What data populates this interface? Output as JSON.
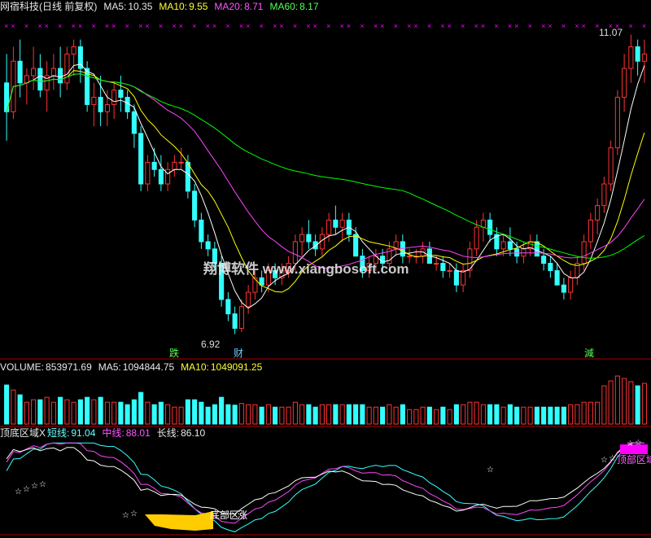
{
  "price_header": {
    "title": "网宿科技(日线 前复权)",
    "ma5_label": "MA5:",
    "ma5_value": "10.35",
    "ma10_label": "MA10:",
    "ma10_value": "9.55",
    "ma20_label": "MA20:",
    "ma20_value": "8.71",
    "ma60_label": "MA60:",
    "ma60_value": "8.17"
  },
  "volume_header": {
    "volume_label": "VOLUME:",
    "volume_value": "853971.69",
    "ma5_label": "MA5:",
    "ma5_value": "1094844.75",
    "ma10_label": "MA10:",
    "ma10_value": "1049091.25"
  },
  "indicator_header": {
    "title": "顶底区域X",
    "short_label": "短线:",
    "short_value": "91.04",
    "mid_label": "中线:",
    "mid_value": "88.01",
    "long_label": "长线:",
    "long_value": "86.10"
  },
  "annotations": {
    "high_price": "11.07",
    "low_price": "6.92",
    "marker_drop": "跌",
    "marker_wealth": "财",
    "marker_reduce": "減",
    "watermark": "翔博软件 www.xiangbosoft.com",
    "bottom_zone_label": "底部区",
    "rise_label": "涨",
    "top_zone_label": "顶部区域",
    "star_marker": "☆",
    "cross_marker": "×"
  },
  "colors": {
    "background": "#000000",
    "up": "#ff3333",
    "down": "#33ffff",
    "ma5": "#ffffff",
    "ma10": "#ffff00",
    "ma20": "#ff44ff",
    "ma60": "#00ff00",
    "divider": "#aa0000",
    "bottom_zone": "#ffcc00",
    "top_zone": "#ff00ff"
  },
  "chart_data": {
    "type": "candlestick",
    "title": "网宿科技(日线 前复权)",
    "candles": [
      [
        10.4,
        10.8,
        9.6,
        10.0
      ],
      [
        10.0,
        10.9,
        9.9,
        10.7
      ],
      [
        10.7,
        11.0,
        10.2,
        10.4
      ],
      [
        10.4,
        10.6,
        10.1,
        10.5
      ],
      [
        10.5,
        10.9,
        10.3,
        10.6
      ],
      [
        10.6,
        10.8,
        10.2,
        10.3
      ],
      [
        10.3,
        10.7,
        10.0,
        10.5
      ],
      [
        10.5,
        10.8,
        10.3,
        10.6
      ],
      [
        10.6,
        10.9,
        10.2,
        10.4
      ],
      [
        10.4,
        10.9,
        10.3,
        10.8
      ],
      [
        10.8,
        11.0,
        10.5,
        10.9
      ],
      [
        10.9,
        11.0,
        10.4,
        10.6
      ],
      [
        10.6,
        10.7,
        10.0,
        10.1
      ],
      [
        10.1,
        10.4,
        9.8,
        10.2
      ],
      [
        10.2,
        10.5,
        9.8,
        10.0
      ],
      [
        10.0,
        10.3,
        9.8,
        10.1
      ],
      [
        10.1,
        10.4,
        9.9,
        10.3
      ],
      [
        10.3,
        10.5,
        10.0,
        10.2
      ],
      [
        10.2,
        10.3,
        9.9,
        10.0
      ],
      [
        10.0,
        10.1,
        9.5,
        9.7
      ],
      [
        9.7,
        9.8,
        8.9,
        9.0
      ],
      [
        9.0,
        9.4,
        8.9,
        9.3
      ],
      [
        9.3,
        9.5,
        9.1,
        9.2
      ],
      [
        9.2,
        9.4,
        8.9,
        9.0
      ],
      [
        9.0,
        9.3,
        8.9,
        9.2
      ],
      [
        9.2,
        9.4,
        9.1,
        9.3
      ],
      [
        9.3,
        9.5,
        9.2,
        9.3
      ],
      [
        9.3,
        9.4,
        8.8,
        8.9
      ],
      [
        8.9,
        9.0,
        8.4,
        8.5
      ],
      [
        8.5,
        8.6,
        8.1,
        8.2
      ],
      [
        8.2,
        8.3,
        8.0,
        8.1
      ],
      [
        8.1,
        8.2,
        7.8,
        7.9
      ],
      [
        7.9,
        8.0,
        7.3,
        7.4
      ],
      [
        7.4,
        7.5,
        7.1,
        7.2
      ],
      [
        7.2,
        7.3,
        6.92,
        7.0
      ],
      [
        7.0,
        7.4,
        6.95,
        7.3
      ],
      [
        7.3,
        7.6,
        7.2,
        7.5
      ],
      [
        7.5,
        7.8,
        7.4,
        7.7
      ],
      [
        7.7,
        7.8,
        7.5,
        7.6
      ],
      [
        7.6,
        7.9,
        7.5,
        7.8
      ],
      [
        7.8,
        7.9,
        7.6,
        7.7
      ],
      [
        7.7,
        7.9,
        7.6,
        7.8
      ],
      [
        7.8,
        8.0,
        7.7,
        7.9
      ],
      [
        7.9,
        8.3,
        7.8,
        8.2
      ],
      [
        8.2,
        8.4,
        8.0,
        8.3
      ],
      [
        8.3,
        8.5,
        8.1,
        8.2
      ],
      [
        8.2,
        8.3,
        8.0,
        8.1
      ],
      [
        8.1,
        8.4,
        8.0,
        8.3
      ],
      [
        8.3,
        8.6,
        8.2,
        8.5
      ],
      [
        8.5,
        8.7,
        8.3,
        8.4
      ],
      [
        8.4,
        8.6,
        8.2,
        8.5
      ],
      [
        8.5,
        8.6,
        8.2,
        8.3
      ],
      [
        8.3,
        8.4,
        8.0,
        8.0
      ],
      [
        8.0,
        8.1,
        7.7,
        7.8
      ],
      [
        7.8,
        8.0,
        7.7,
        7.9
      ],
      [
        7.9,
        8.1,
        7.8,
        8.0
      ],
      [
        8.0,
        8.1,
        7.8,
        7.9
      ],
      [
        7.9,
        8.2,
        7.8,
        8.1
      ],
      [
        8.1,
        8.3,
        8.0,
        8.2
      ],
      [
        8.2,
        8.3,
        7.9,
        8.0
      ],
      [
        8.0,
        8.1,
        7.9,
        8.0
      ],
      [
        8.0,
        8.1,
        7.9,
        8.0
      ],
      [
        8.0,
        8.2,
        7.9,
        8.1
      ],
      [
        8.1,
        8.2,
        7.9,
        7.9
      ],
      [
        7.9,
        8.0,
        7.8,
        7.9
      ],
      [
        7.9,
        8.0,
        7.7,
        7.8
      ],
      [
        7.8,
        7.9,
        7.7,
        7.8
      ],
      [
        7.8,
        7.9,
        7.5,
        7.6
      ],
      [
        7.6,
        7.9,
        7.5,
        7.8
      ],
      [
        7.8,
        8.2,
        7.7,
        8.1
      ],
      [
        8.1,
        8.5,
        8.0,
        8.4
      ],
      [
        8.4,
        8.6,
        8.2,
        8.5
      ],
      [
        8.5,
        8.6,
        8.2,
        8.3
      ],
      [
        8.3,
        8.4,
        8.0,
        8.1
      ],
      [
        8.1,
        8.3,
        8.0,
        8.2
      ],
      [
        8.2,
        8.4,
        8.0,
        8.1
      ],
      [
        8.1,
        8.2,
        7.9,
        8.0
      ],
      [
        8.0,
        8.2,
        7.9,
        8.1
      ],
      [
        8.1,
        8.3,
        8.0,
        8.2
      ],
      [
        8.2,
        8.3,
        8.0,
        8.0
      ],
      [
        8.0,
        8.1,
        7.8,
        7.9
      ],
      [
        7.9,
        8.0,
        7.7,
        7.8
      ],
      [
        7.8,
        7.9,
        7.6,
        7.6
      ],
      [
        7.6,
        7.7,
        7.4,
        7.5
      ],
      [
        7.5,
        7.8,
        7.4,
        7.7
      ],
      [
        7.7,
        8.0,
        7.6,
        7.9
      ],
      [
        7.9,
        8.3,
        7.8,
        8.2
      ],
      [
        8.2,
        8.6,
        8.1,
        8.5
      ],
      [
        8.5,
        8.8,
        8.3,
        8.7
      ],
      [
        8.7,
        9.1,
        8.6,
        9.0
      ],
      [
        9.0,
        9.6,
        8.9,
        9.5
      ],
      [
        9.5,
        10.3,
        9.4,
        10.2
      ],
      [
        10.2,
        10.8,
        10.0,
        10.6
      ],
      [
        10.6,
        11.07,
        10.4,
        10.9
      ],
      [
        10.9,
        11.0,
        10.5,
        10.7
      ],
      [
        10.7,
        11.0,
        10.4,
        10.8
      ]
    ],
    "volume_note": "VOLUME 853971.69"
  }
}
